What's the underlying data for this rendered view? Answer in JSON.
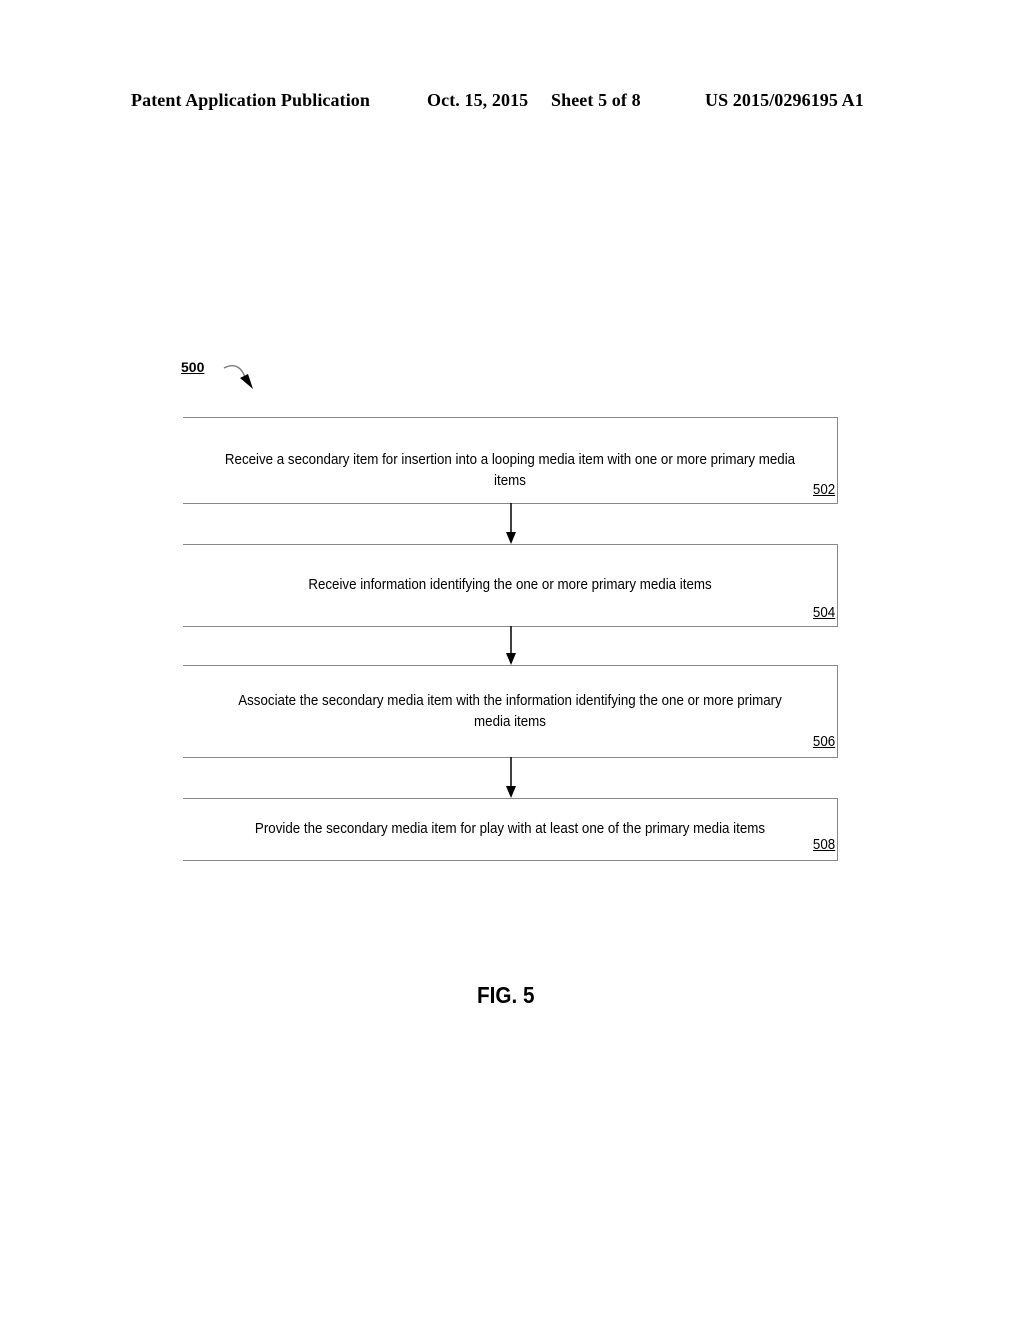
{
  "header": {
    "publication": "Patent Application Publication",
    "date": "Oct. 15, 2015",
    "sheet": "Sheet 5 of 8",
    "number": "US 2015/0296195 A1"
  },
  "figure": {
    "reference": "500",
    "caption": "FIG. 5",
    "steps": [
      {
        "text": "Receive a secondary item for insertion into a looping media item with one or more primary media items",
        "ref": "502"
      },
      {
        "text": "Receive information identifying the one or more primary media items",
        "ref": "504"
      },
      {
        "text": "Associate the secondary media item with the information identifying the one or more primary media items",
        "ref": "506"
      },
      {
        "text": "Provide the secondary media item for play with at least one of the primary media items",
        "ref": "508"
      }
    ]
  }
}
